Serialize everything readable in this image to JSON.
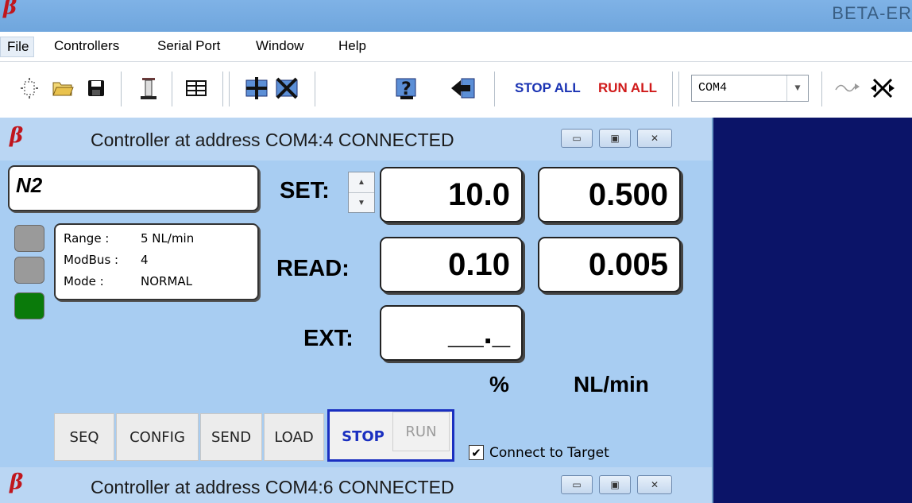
{
  "app": {
    "logo": "β",
    "title": "BETA-ER"
  },
  "menu": [
    "File",
    "Controllers",
    "Serial Port",
    "Window",
    "Help"
  ],
  "toolbar": {
    "icons": [
      "new-icon",
      "open-folder-icon",
      "save-icon",
      "flask-icon",
      "table-icon",
      "add-controller-icon",
      "remove-controller-icon",
      "help-icon",
      "exit-icon"
    ],
    "stop_all": "STOP ALL",
    "run_all": "RUN ALL",
    "com_port": "COM4",
    "connect_icon": "connect-icon",
    "disconnect_icon": "disconnect-icon"
  },
  "controller": {
    "title": "Controller at address COM4:4 CONNECTED",
    "gas": "N2",
    "leds": [
      "#9a9a9a",
      "#9a9a9a",
      "#0a7a0a"
    ],
    "info": [
      {
        "k": "Range :",
        "v": "5 NL/min"
      },
      {
        "k": "ModBus :",
        "v": "4"
      },
      {
        "k": "Mode :",
        "v": "NORMAL"
      }
    ],
    "set_label": "SET:",
    "read_label": "READ:",
    "ext_label": "EXT:",
    "set_percent": "10.0",
    "set_flow": "0.500",
    "read_percent": "0.10",
    "read_flow": "0.005",
    "ext_value": "__._",
    "unit_percent": "%",
    "unit_flow": "NL/min",
    "buttons": {
      "seq": "SEQ",
      "config": "CONFIG",
      "send": "SEND",
      "load": "LOAD",
      "stop": "STOP",
      "run": "RUN"
    },
    "connect_to_target": "Connect to Target",
    "connect_checked": true
  },
  "controller2": {
    "title": "Controller at address COM4:6 CONNECTED"
  }
}
